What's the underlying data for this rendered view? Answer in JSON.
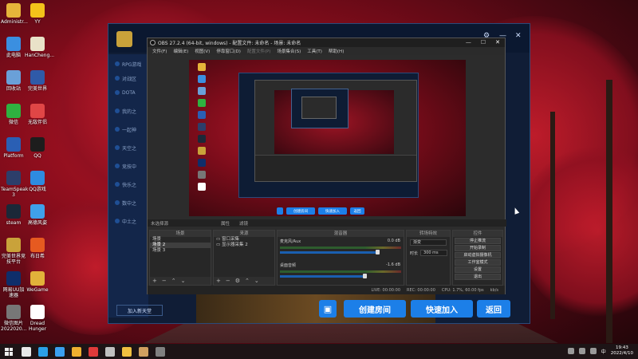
{
  "desktop": {
    "icons": [
      {
        "label": "Administr...",
        "color": "#e6b43a"
      },
      {
        "label": "YY",
        "color": "#f3c21a"
      },
      {
        "label": "此电脑",
        "color": "#3b8fe0"
      },
      {
        "label": "HanCheng...",
        "color": "#e9e2c8"
      },
      {
        "label": "回收站",
        "color": "#6aa0d8"
      },
      {
        "label": "完美世界",
        "color": "#2f5aa8"
      },
      {
        "label": "微信",
        "color": "#2fb140"
      },
      {
        "label": "无敌伴侣",
        "color": "#e04646"
      },
      {
        "label": "Platform",
        "color": "#2a5fb4"
      },
      {
        "label": "QQ",
        "color": "#1d1d1d"
      },
      {
        "label": "TeamSpeak 3",
        "color": "#2d3e6a"
      },
      {
        "label": "QQ游戏",
        "color": "#2e8be0"
      },
      {
        "label": "steam",
        "color": "#1b2838"
      },
      {
        "label": "高德风姿",
        "color": "#3fa0ea"
      },
      {
        "label": "完美世界竞技平台",
        "color": "#c9a23a"
      },
      {
        "label": "布日希",
        "color": "#e65a20"
      },
      {
        "label": "网易UU加速器",
        "color": "#0f2e6a"
      },
      {
        "label": "WeGame",
        "color": "#e2b23a"
      },
      {
        "label": "微信图片 2022020...",
        "color": "#777777"
      },
      {
        "label": "Dread Hunger",
        "color": "#ffffff"
      }
    ]
  },
  "launcher": {
    "menu": [
      "RPG游戏",
      "对战区",
      "DOTA",
      "我的之",
      "一起神",
      "天空之",
      "竞技中",
      "快乐之",
      "数中之",
      "中土之"
    ],
    "join_friend": "加入新天堂",
    "create_room": "创建房间",
    "quick_join": "快速加入",
    "back": "返回",
    "window_controls": [
      "⚙",
      "—",
      "✕"
    ]
  },
  "obs": {
    "title": "OBS 27.2.4 (64-bit, windows) - 配置文件: 未命名 - 场景: 未命名",
    "menu": [
      "文件(F)",
      "编辑(E)",
      "视图(V)",
      "停靠窗口(D)",
      "配置文件(P)",
      "场景集合(S)",
      "工具(T)",
      "帮助(H)"
    ],
    "dock_header_left": "未选择源",
    "dock_header_mid1": "属性",
    "dock_header_mid2": "滤镜",
    "scenes_title": "场景",
    "scenes": [
      "场景",
      "场景 2",
      "场景 3"
    ],
    "sources_title": "来源",
    "sources": [
      "窗口采集",
      "显示器采集 2"
    ],
    "mixer_title": "混音器",
    "mixer": [
      {
        "name": "麦克风/Aux",
        "db": "0.0 dB"
      },
      {
        "name": "桌面音频",
        "db": "-1.6 dB"
      }
    ],
    "transitions_title": "转场特效",
    "transition_value": "渐变",
    "duration_label": "时长",
    "duration_value": "300 ms",
    "controls_title": "控件",
    "controls": [
      "停止推流",
      "开始录制",
      "启动虚拟摄像机",
      "工作室模式",
      "设置",
      "退出"
    ],
    "status": {
      "live": "LIVE: 00:00:00",
      "rec": "REC: 00:00:00",
      "cpu": "CPU: 1.7%, 60.00 fps",
      "kb": "kb/s"
    },
    "window_controls": [
      "—",
      "☐",
      "✕"
    ]
  },
  "taskbar": {
    "time": "19:43",
    "date": "2022/4/10",
    "ime": "中",
    "colors": [
      "#e9e9e9",
      "#2aa0e8",
      "#3aa0f0",
      "#f0b030",
      "#e03a3a",
      "#c0c0c0",
      "#f0c040",
      "#d0a060",
      "#808080"
    ]
  }
}
